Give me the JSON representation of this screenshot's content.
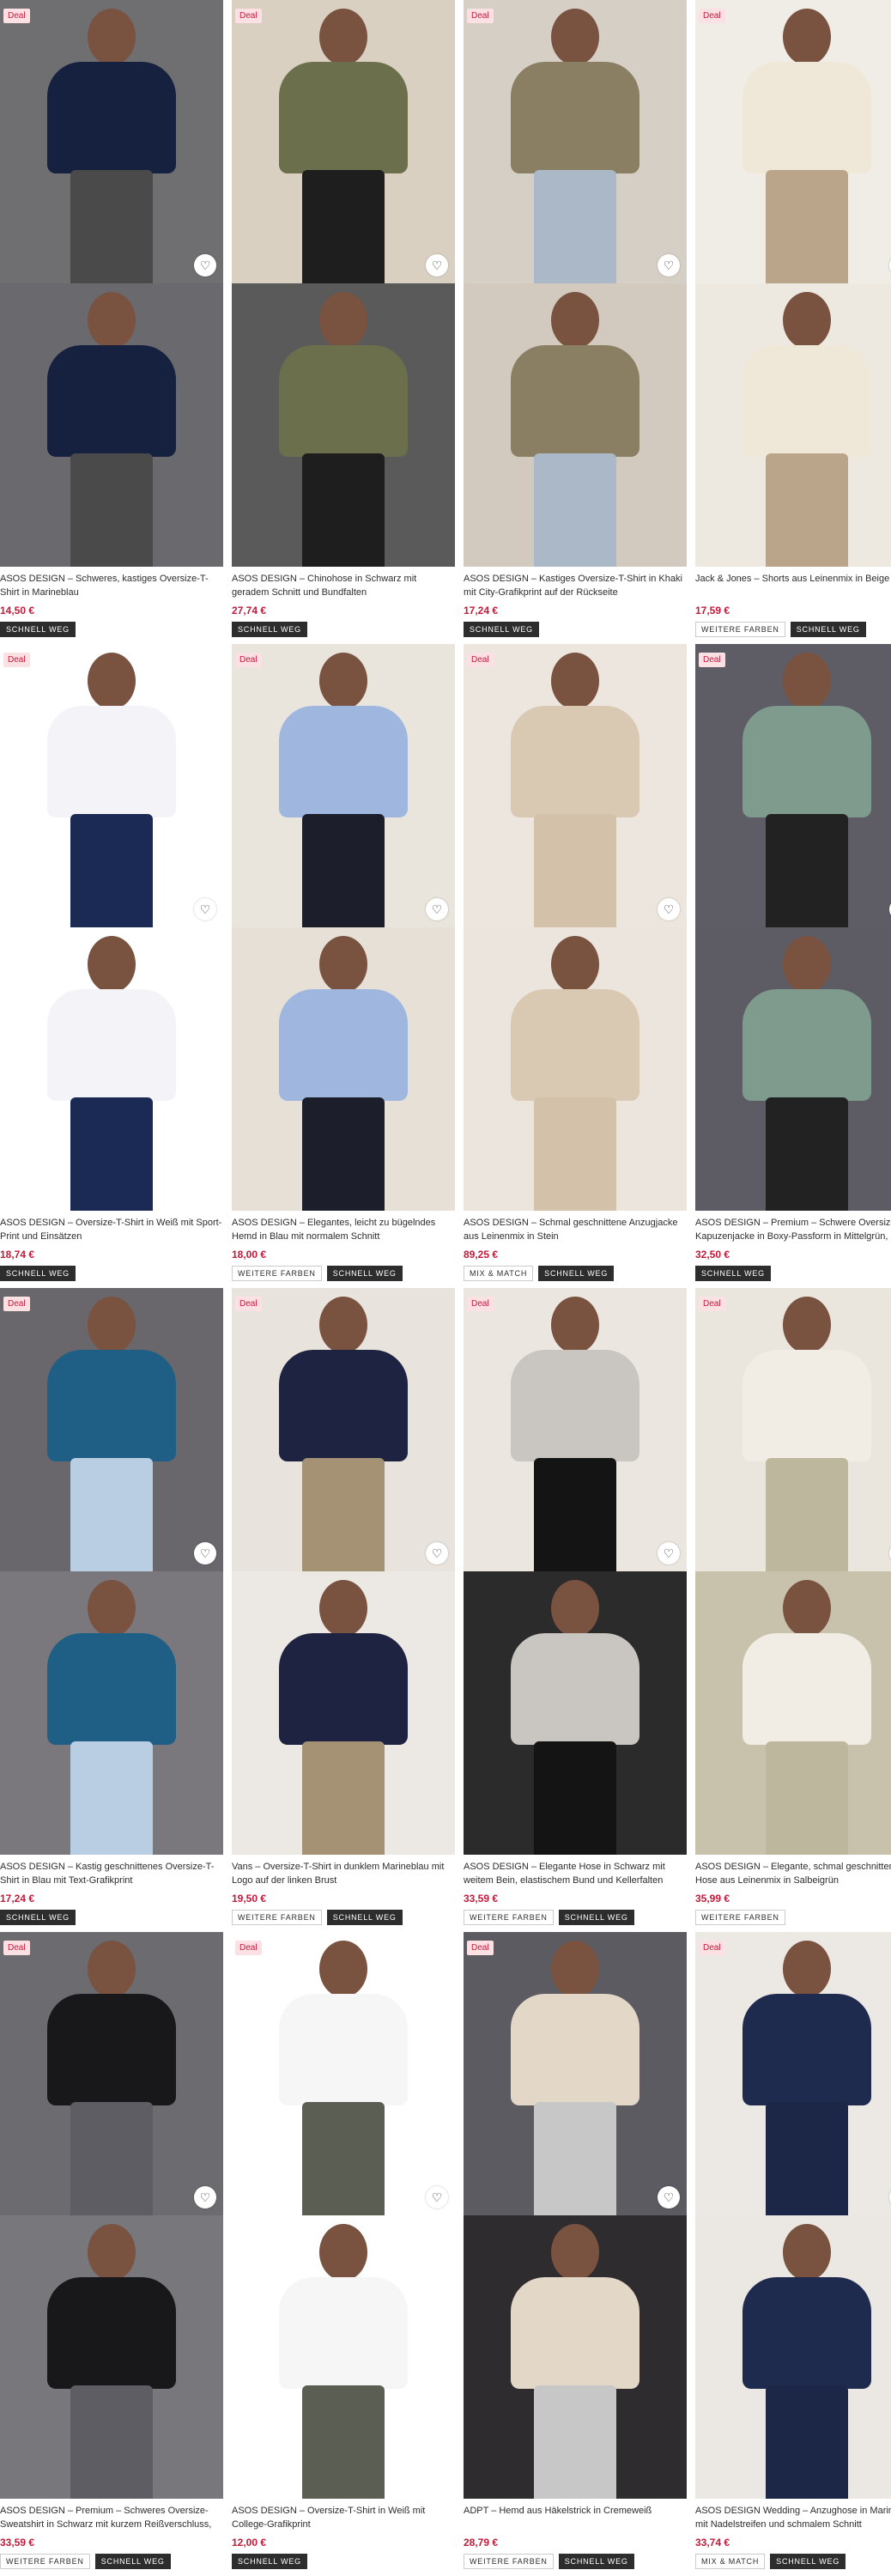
{
  "labels": {
    "deal": "Deal",
    "save_icon": "heart-icon"
  },
  "products": [
    {
      "title": "ASOS DESIGN – Schweres, kastiges Oversize-T-Shirt in Marineblau",
      "price": "14,50 €",
      "deal": true,
      "badges": [
        "SCHNELL WEG"
      ],
      "bg": "#6f6f72",
      "top": "#16203f",
      "bottom": "#4a4a4a",
      "photo2": "#6a6a6e"
    },
    {
      "title": "ASOS DESIGN – Chinohose in Schwarz mit geradem Schnitt und Bundfalten",
      "price": "27,74 €",
      "deal": true,
      "badges": [
        "SCHNELL WEG"
      ],
      "bg": "#d9d0c2",
      "top": "#6b6f4c",
      "bottom": "#1e1e1e",
      "photo2": "#5a5a5a"
    },
    {
      "title": "ASOS DESIGN – Kastiges Oversize-T-Shirt in Khaki mit City-Grafikprint auf der Rückseite",
      "price": "17,24 €",
      "deal": true,
      "badges": [
        "SCHNELL WEG"
      ],
      "bg": "#d6cfc6",
      "top": "#8a7f63",
      "bottom": "#aab8c8",
      "photo2": "#d2cabe"
    },
    {
      "title": "Jack & Jones – Shorts aus Leinenmix in Beige",
      "price": "17,59 €",
      "deal": true,
      "badges": [
        "WEITERE FARBEN",
        "SCHNELL WEG"
      ],
      "bg": "#f0ece6",
      "top": "#efe8d8",
      "bottom": "#bba58a",
      "photo2": "#ede8e0"
    },
    {
      "title": "ASOS DESIGN – Oversize-T-Shirt in Weiß mit Sport-Print und Einsätzen",
      "price": "18,74 €",
      "deal": true,
      "badges": [
        "SCHNELL WEG"
      ],
      "bg": "#ffffff",
      "top": "#f4f4f8",
      "bottom": "#1b2a55",
      "photo2": "#ffffff"
    },
    {
      "title": "ASOS DESIGN – Elegantes, leicht zu bügelndes Hemd in Blau mit normalem Schnitt",
      "price": "18,00 €",
      "deal": true,
      "badges": [
        "WEITERE FARBEN",
        "SCHNELL WEG"
      ],
      "bg": "#e9e4dc",
      "top": "#9fb6de",
      "bottom": "#1c1f2b",
      "photo2": "#e6e0d6"
    },
    {
      "title": "ASOS DESIGN – Schmal geschnittene Anzugjacke aus Leinenmix in Stein",
      "price": "89,25 €",
      "deal": true,
      "badges": [
        "MIX & MATCH",
        "SCHNELL WEG"
      ],
      "bg": "#ece6de",
      "top": "#d9c9b2",
      "bottom": "#d3c2a9",
      "photo2": "#ebe5dd"
    },
    {
      "title": "ASOS DESIGN – Premium – Schwere Oversize-Kapuzenjacke in Boxy-Passform in Mittelgrün, mit",
      "price": "32,50 €",
      "deal": true,
      "badges": [
        "SCHNELL WEG"
      ],
      "bg": "#5e5d65",
      "top": "#7f9b8d",
      "bottom": "#222222",
      "photo2": "#5d5c64"
    },
    {
      "title": "ASOS DESIGN – Kastig geschnittenes Oversize-T-Shirt in Blau mit Text-Grafikprint",
      "price": "17,24 €",
      "deal": true,
      "badges": [
        "SCHNELL WEG"
      ],
      "bg": "#69676c",
      "top": "#1f5f86",
      "bottom": "#b9cde3",
      "photo2": "#7a787d"
    },
    {
      "title": "Vans – Oversize-T-Shirt in dunklem Marineblau mit Logo auf der linken Brust",
      "price": "19,50 €",
      "deal": true,
      "badges": [
        "WEITERE FARBEN",
        "SCHNELL WEG"
      ],
      "bg": "#e8e3dc",
      "top": "#1d2340",
      "bottom": "#a59274",
      "photo2": "#ece8e3"
    },
    {
      "title": "ASOS DESIGN – Elegante Hose in Schwarz mit weitem Bein, elastischem Bund und Kellerfalten",
      "price": "33,59 €",
      "deal": true,
      "badges": [
        "WEITERE FARBEN",
        "SCHNELL WEG"
      ],
      "bg": "#ebe6df",
      "top": "#c9c6c1",
      "bottom": "#141414",
      "photo2": "#2b2b2b"
    },
    {
      "title": "ASOS DESIGN – Elegante, schmal geschnittene Hose aus Leinenmix in Salbeigrün",
      "price": "35,99 €",
      "deal": true,
      "badges": [
        "WEITERE FARBEN"
      ],
      "bg": "#eae5dd",
      "top": "#f1ede4",
      "bottom": "#bdb79e",
      "photo2": "#c8c2ad"
    },
    {
      "title": "ASOS DESIGN – Premium – Schweres Oversize-Sweatshirt in Schwarz mit kurzem Reißverschluss,",
      "price": "33,59 €",
      "deal": true,
      "badges": [
        "WEITERE FARBEN",
        "SCHNELL WEG"
      ],
      "bg": "#6c6b70",
      "top": "#18181a",
      "bottom": "#5d5d63",
      "photo2": "#78777c"
    },
    {
      "title": "ASOS DESIGN – Oversize-T-Shirt in Weiß mit College-Grafikprint",
      "price": "12,00 €",
      "deal": true,
      "badges": [
        "SCHNELL WEG"
      ],
      "bg": "#ffffff",
      "top": "#f6f6f6",
      "bottom": "#5b5e53",
      "photo2": "#ffffff"
    },
    {
      "title": "ADPT – Hemd aus Häkelstrick in Cremeweiß",
      "price": "28,79 €",
      "deal": true,
      "badges": [
        "WEITERE FARBEN",
        "SCHNELL WEG"
      ],
      "bg": "#5c5b61",
      "top": "#e3d8c7",
      "bottom": "#c7c7c7",
      "photo2": "#2e2c2f"
    },
    {
      "title": "ASOS DESIGN Wedding – Anzughose in Marineblau mit Nadelstreifen und schmalem Schnitt",
      "price": "33,74 €",
      "deal": true,
      "badges": [
        "MIX & MATCH",
        "SCHNELL WEG"
      ],
      "bg": "#ece8e3",
      "top": "#1e2b4f",
      "bottom": "#1c2747",
      "photo2": "#ebe7e2"
    }
  ]
}
